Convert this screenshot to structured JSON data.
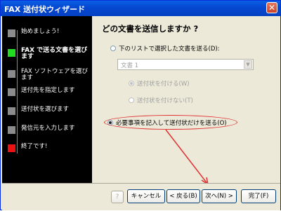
{
  "window": {
    "title": "FAX 送付状ウィザード",
    "close_glyph": "✕"
  },
  "sidebar": {
    "steps": [
      {
        "label": "始めましょう!",
        "state": "done"
      },
      {
        "label": "FAX で送る文書を選びます",
        "state": "active"
      },
      {
        "label": "FAX ソフトウェアを選びます",
        "state": "todo"
      },
      {
        "label": "送付先を指定します",
        "state": "todo"
      },
      {
        "label": "送付状を選びます",
        "state": "todo"
      },
      {
        "label": "発信元を入力します",
        "state": "todo"
      },
      {
        "label": "終了です!",
        "state": "final"
      }
    ]
  },
  "main": {
    "heading": "どの文書を送信しますか ?",
    "option_list": "下のリストで選択した文書を送る(D):",
    "document_select": {
      "value": "文書 1"
    },
    "option_with_cover": "送付状を付ける(W)",
    "option_without_cover": "送付状を付けない(T)",
    "option_cover_only": "必要事項を記入して送付状だけを送る(O)"
  },
  "footer": {
    "help_glyph": "?",
    "cancel": "キャンセル",
    "back": "< 戻る(B)",
    "next": "次へ(N) >",
    "finish": "完了(F)"
  },
  "colors": {
    "title_bar": "#0a5fe4",
    "sidebar_bg": "#000000",
    "active_step": "#22dd22",
    "final_step": "#ee1111",
    "annotation": "#e03030"
  }
}
